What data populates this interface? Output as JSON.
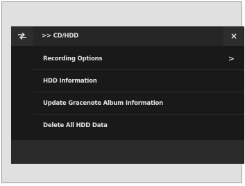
{
  "header": {
    "title": ">> CD/HDD",
    "back_icon": "back-arrow-icon",
    "close_label": "×"
  },
  "menu": {
    "items": [
      {
        "label": "Recording Options",
        "chevron": ">"
      },
      {
        "label": "HDD Information"
      },
      {
        "label": "Update Gracenote Album Information"
      },
      {
        "label": "Delete All HDD Data"
      }
    ]
  },
  "colors": {
    "screen_background": "#191919",
    "header_background": "#262626",
    "text": "#e2e2e2",
    "frame": "#e0e0e0"
  }
}
